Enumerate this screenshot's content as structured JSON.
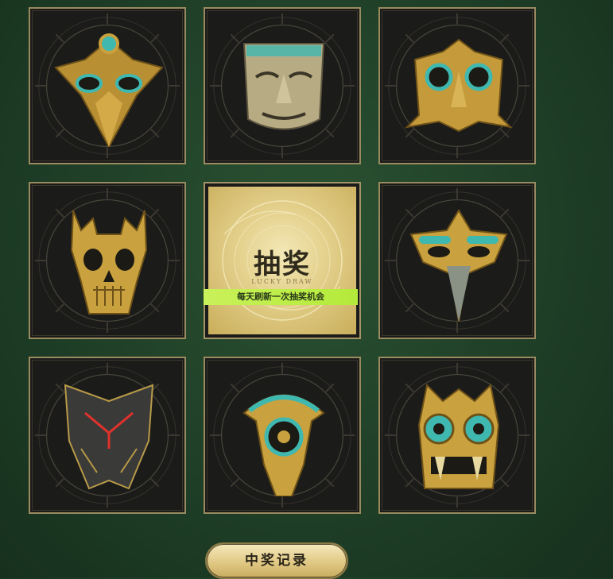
{
  "grid": {
    "cells": [
      {
        "icon": "eagle-mask-icon"
      },
      {
        "icon": "bronze-face-mask-icon"
      },
      {
        "icon": "owl-mask-icon"
      },
      {
        "icon": "horned-skull-mask-icon"
      },
      {
        "icon": "lucky-draw-center"
      },
      {
        "icon": "bird-beak-mask-icon"
      },
      {
        "icon": "mech-helmet-mask-icon"
      },
      {
        "icon": "sun-crest-mask-icon"
      },
      {
        "icon": "jade-eye-fang-mask-icon"
      }
    ],
    "center": {
      "title": "抽奖",
      "subtitle": "LUCKY DRAW",
      "note": "每天刷新一次抽奖机会"
    }
  },
  "footer": {
    "record_button": "中奖记录"
  },
  "colors": {
    "background": "#1f3f27",
    "frame_gold": "#9a8a60",
    "mask_gold": "#c9a13e",
    "turquoise": "#3fb8b0",
    "note_green": "#c9f15a"
  }
}
